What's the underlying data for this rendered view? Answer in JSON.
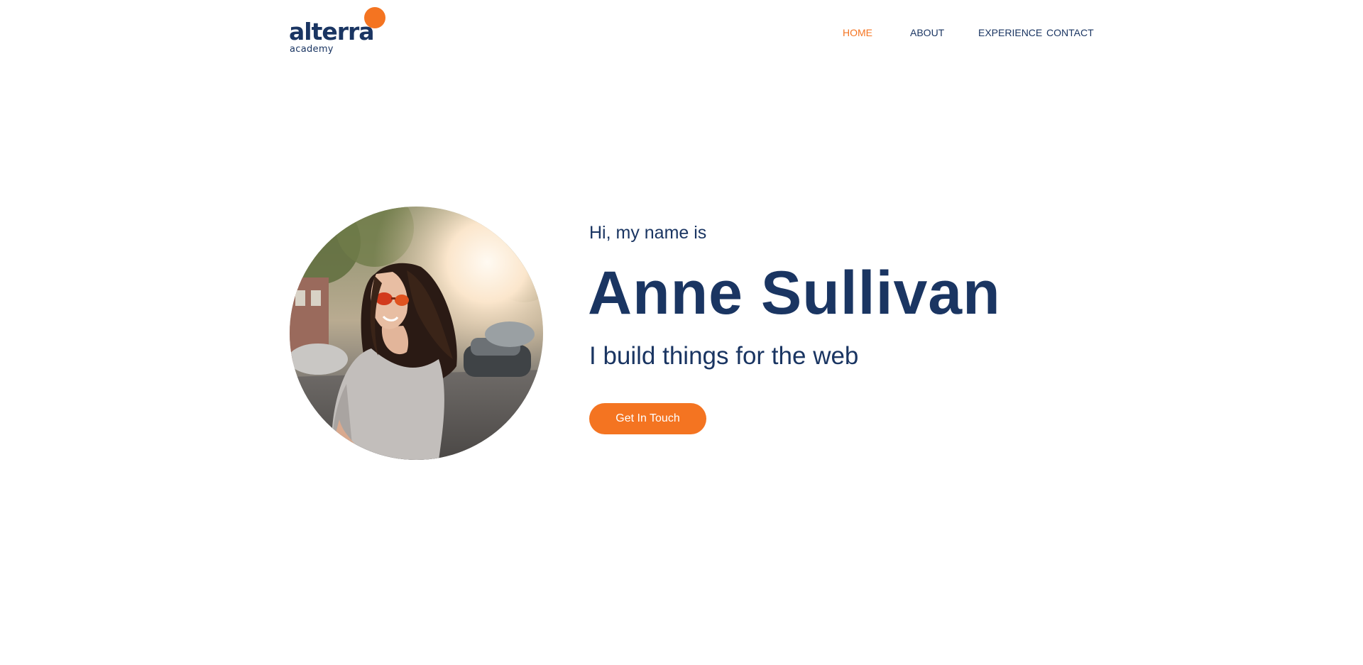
{
  "brand": {
    "name": "alterra",
    "subtitle": "academy",
    "primary_color": "#1a3562",
    "accent_color": "#f47421"
  },
  "nav": {
    "items": [
      {
        "label": "HOME",
        "active": true
      },
      {
        "label": "ABOUT",
        "active": false
      },
      {
        "label": "EXPERIENCE",
        "active": false
      },
      {
        "label": "CONTACT",
        "active": false
      }
    ]
  },
  "hero": {
    "greeting": "Hi, my name is",
    "name": "Anne Sullivan",
    "tagline": "I build things for the web",
    "cta_label": "Get In Touch",
    "photo": "profile-photo"
  }
}
